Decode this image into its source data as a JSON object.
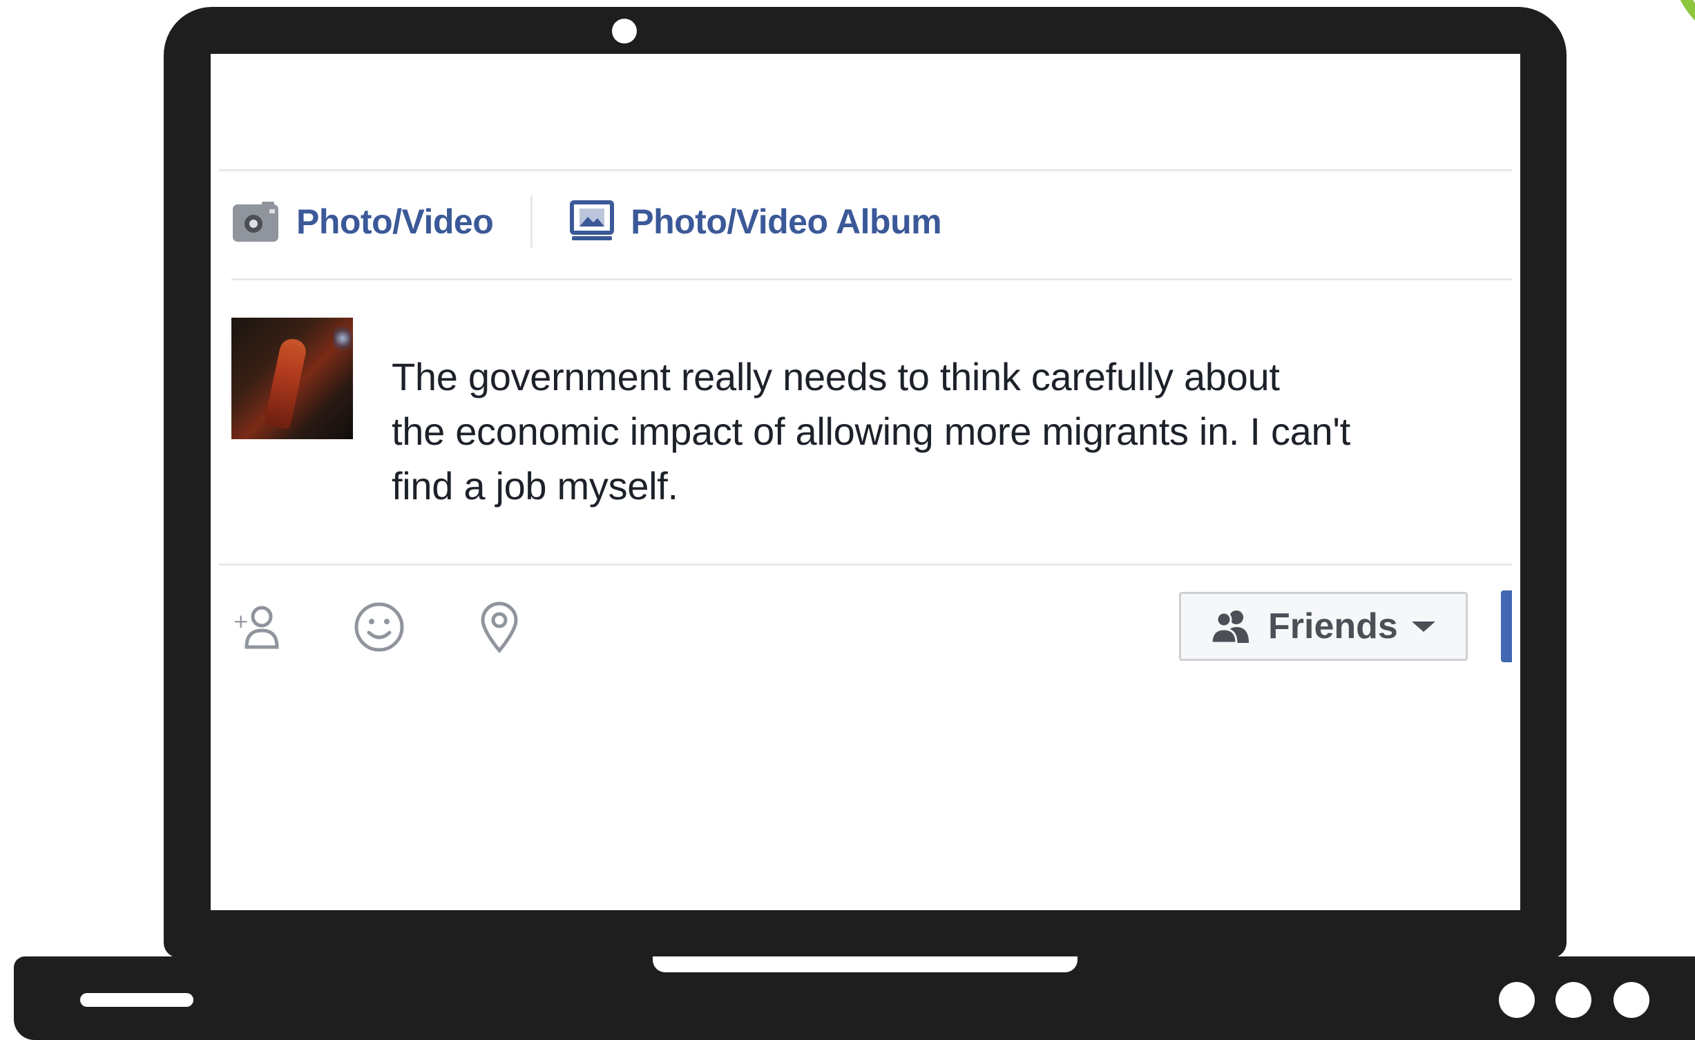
{
  "composer": {
    "attachments": {
      "photo_video_label": "Photo/Video",
      "photo_video_album_label": "Photo/Video Album"
    },
    "post_text": "The government really needs to think carefully about\nthe economic impact of allowing more migrants in. I can't\nfind a job myself.",
    "footer": {
      "icons": [
        "tag-friends-icon",
        "feeling-emoji-icon",
        "check-in-location-icon"
      ],
      "audience_label": "Friends"
    }
  },
  "colors": {
    "link_blue": "#3b5998",
    "post_button_blue": "#4267b2",
    "text": "#1d2129",
    "divider": "#e6e8ec",
    "laptop_body": "#1e1e1e",
    "accent_green": "#8cc63f"
  }
}
